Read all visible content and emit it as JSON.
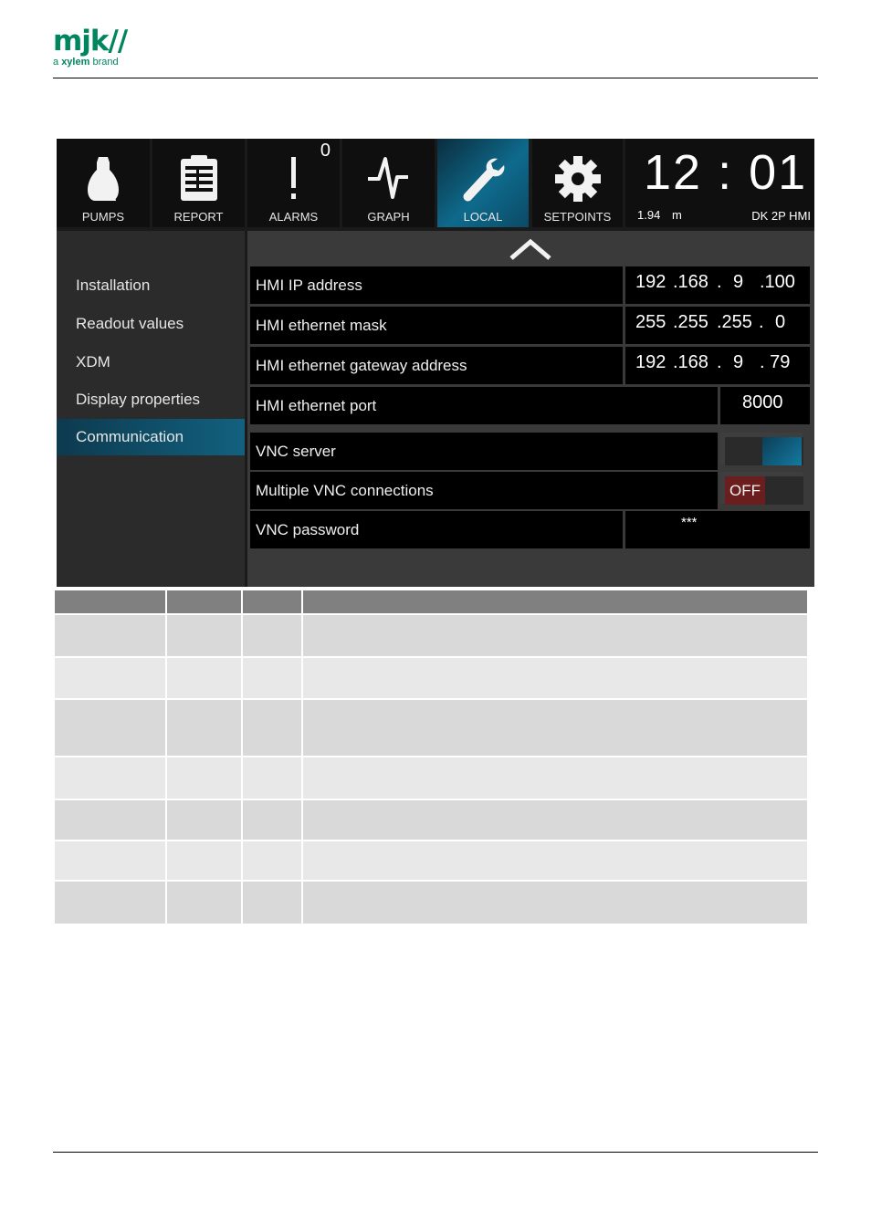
{
  "brand": {
    "mark": "mjk//",
    "tagline_prefix": "a ",
    "tagline_bold": "xylem",
    "tagline_suffix": " brand"
  },
  "tabs": [
    {
      "label": "PUMPS",
      "icon": "pump-icon"
    },
    {
      "label": "REPORT",
      "icon": "clipboard-icon"
    },
    {
      "label": "ALARMS",
      "icon": "alarm-exclamation-icon",
      "count": "0"
    },
    {
      "label": "GRAPH",
      "icon": "pulse-graph-icon"
    },
    {
      "label": "LOCAL",
      "icon": "wrench-icon",
      "active": true
    },
    {
      "label": "SETPOINTS",
      "icon": "gear-icon"
    }
  ],
  "status": {
    "time": "12 : 01",
    "level_value": "1.94",
    "level_unit": "m",
    "device_name": "DK 2P HMI"
  },
  "sidebar": {
    "items": [
      {
        "label": "Installation"
      },
      {
        "label": "Readout values"
      },
      {
        "label": "XDM"
      },
      {
        "label": "Display properties"
      },
      {
        "label": "Communication",
        "active": true
      }
    ]
  },
  "settings": {
    "ip_label": "HMI IP address",
    "ip_octets": [
      "192",
      ".168",
      ".",
      "9",
      ".100"
    ],
    "mask_label": "HMI ethernet mask",
    "mask_octets": [
      "255",
      ".255",
      ".255",
      ".",
      "0"
    ],
    "gateway_label": "HMI ethernet gateway address",
    "gateway_octets": [
      "192",
      ".168",
      ".",
      "9",
      ". 79"
    ],
    "port_label": "HMI ethernet port",
    "port_value": "8000",
    "vnc_server_label": "VNC server",
    "vnc_server_state": "on",
    "multi_vnc_label": "Multiple VNC connections",
    "multi_vnc_state": "OFF",
    "vnc_password_label": "VNC password",
    "vnc_password_value": "***"
  },
  "colors": {
    "brand_green": "#00855f",
    "active_blue": "#0e6a8c",
    "off_red": "#8b1d1d",
    "table_header": "#808080"
  }
}
